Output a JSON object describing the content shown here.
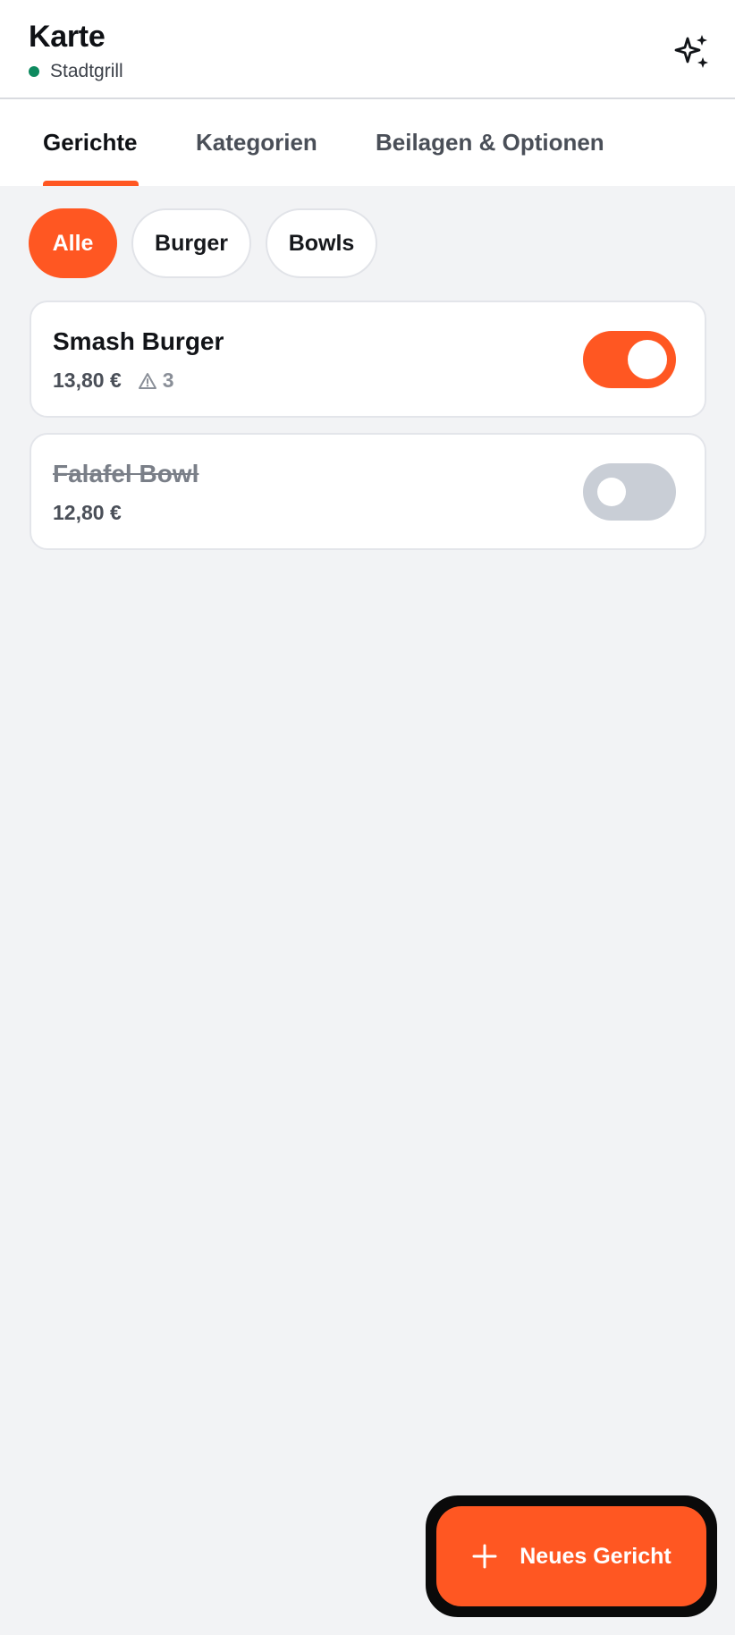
{
  "header": {
    "title": "Karte",
    "restaurant": "Stadtgrill",
    "status_color": "#0e8a5f",
    "action_icon": "sparkles-icon"
  },
  "tabs": [
    {
      "label": "Gerichte",
      "active": true
    },
    {
      "label": "Kategorien",
      "active": false
    },
    {
      "label": "Beilagen & Optionen",
      "active": false
    }
  ],
  "filters": [
    {
      "label": "Alle",
      "active": true
    },
    {
      "label": "Burger",
      "active": false
    },
    {
      "label": "Bowls",
      "active": false
    }
  ],
  "dishes": [
    {
      "name": "Smash Burger",
      "price": "13,80 €",
      "warnings": "3",
      "available": true
    },
    {
      "name": "Falafel Bowl",
      "price": "12,80 €",
      "available": false
    }
  ],
  "fab": {
    "label": "Neues Gericht",
    "icon": "plus-icon"
  },
  "colors": {
    "accent": "#ff5722",
    "toggle_off": "#c9ced6",
    "background": "#f2f3f5"
  }
}
